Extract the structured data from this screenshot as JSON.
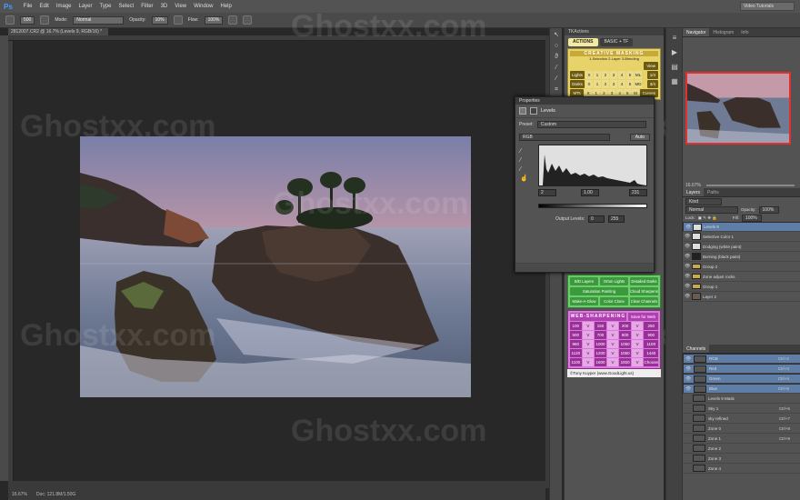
{
  "menubar": {
    "logo": "Ps",
    "items": [
      "File",
      "Edit",
      "Image",
      "Layer",
      "Type",
      "Select",
      "Filter",
      "3D",
      "View",
      "Window",
      "Help"
    ],
    "workspace": "Video Tutorials"
  },
  "options": {
    "brush_size": "500",
    "mode_label": "Mode:",
    "mode_value": "Normal",
    "opacity_label": "Opacity:",
    "opacity_value": "10%",
    "flow_label": "Flow:",
    "flow_value": "100%"
  },
  "document": {
    "tab_title": "2812007.CR2 @ 16.7% (Levels 9, RGB/16) *",
    "zoom": "16.67%",
    "doc_info": "Doc: 121.8M/1.50G"
  },
  "watermark": "Ghostxx.com",
  "actions_panel": {
    "title": "TKActions",
    "tabs": [
      "ACTIONS",
      "BASIC + TF"
    ],
    "creative_masking": {
      "title": "CREATIVE MASKING",
      "subtitle": "1-Selection 2-Layer 3-Blending",
      "rows": [
        {
          "label": "Lights",
          "nums": [
            "X",
            "1",
            "2",
            "3",
            "4",
            "5",
            "ML"
          ],
          "btn": "1/4"
        },
        {
          "label": "Darks",
          "nums": [
            "X",
            "1",
            "2",
            "3",
            "4",
            "5",
            "MD"
          ],
          "btn": "3/4"
        },
        {
          "label": "MTs",
          "nums": [
            "X",
            "1",
            "2",
            "3",
            "4",
            "5",
            "M"
          ],
          "btn": "Curves"
        }
      ],
      "view_btn": "View"
    },
    "green_buttons": [
      "B/D Layers",
      "Orton Lights",
      "Detailed Darks",
      "Saturation Painting",
      "Cloud Sharpening",
      "Make-A-Glow",
      "Color Clone",
      "Clear Channels"
    ],
    "web_sharpening": {
      "title": "WEB-SHARPENING",
      "save": "Save for Web",
      "rows": [
        [
          "100",
          "V",
          "150",
          "V",
          "200",
          "V",
          "250"
        ],
        [
          "500",
          "V",
          "700",
          "V",
          "800",
          "V",
          "900"
        ],
        [
          "960",
          "V",
          "1000",
          "V",
          "1050",
          "V",
          "1100"
        ],
        [
          "1120",
          "V",
          "1200",
          "V",
          "1050",
          "V",
          "1440"
        ],
        [
          "1100",
          "V",
          "1600",
          "V",
          "1920",
          "V",
          "Choose"
        ]
      ]
    },
    "footer": "©Tony Kuyper (www.GoodLight.us)"
  },
  "properties_panel": {
    "title": "Properties",
    "adjust_name": "Levels",
    "preset_label": "Preset:",
    "preset_value": "Custom",
    "channel_value": "RGB",
    "auto_btn": "Auto",
    "input_black": "2",
    "input_mid": "1.00",
    "input_white": "231",
    "output_label": "Output Levels:",
    "output_black": "0",
    "output_white": "255"
  },
  "right_panel": {
    "tabs": [
      "Navigator",
      "Histogram",
      "Info"
    ],
    "zoom": "16.67%",
    "layer_tabs": [
      "Layers",
      "Paths"
    ],
    "kind": "Kind",
    "blend": "Normal",
    "opacity_label": "Opacity:",
    "opacity_value": "100%",
    "lock_label": "Lock:",
    "fill_label": "Fill:",
    "fill_value": "100%",
    "layers": [
      {
        "name": "Levels 9",
        "selected": true,
        "thumb": "light"
      },
      {
        "name": "Selective Color 1",
        "selected": false,
        "thumb": "light"
      },
      {
        "name": "Dodging (white paint)",
        "selected": false,
        "thumb": "light"
      },
      {
        "name": "Burning (black paint)",
        "selected": false,
        "thumb": "dark"
      },
      {
        "name": "Group 2",
        "selected": false,
        "thumb": "folder"
      },
      {
        "name": "Zone adjust rocks",
        "selected": false,
        "thumb": "folder"
      },
      {
        "name": "Group 1",
        "selected": false,
        "thumb": "folder"
      },
      {
        "name": "Layer 2",
        "selected": false,
        "thumb": "photo"
      }
    ],
    "channels_tab": "Channels",
    "channels": [
      {
        "name": "RGB",
        "key": "Ctrl+2",
        "selected": true
      },
      {
        "name": "Red",
        "key": "Ctrl+3",
        "selected": true
      },
      {
        "name": "Green",
        "key": "Ctrl+4",
        "selected": true
      },
      {
        "name": "Blue",
        "key": "Ctrl+5",
        "selected": true
      },
      {
        "name": "Levels 9 Mask",
        "key": "",
        "selected": false
      },
      {
        "name": "Sky 1",
        "key": "Ctrl+6",
        "selected": false
      },
      {
        "name": "sky refined",
        "key": "Ctrl+7",
        "selected": false
      },
      {
        "name": "Zone 0",
        "key": "Ctrl+8",
        "selected": false
      },
      {
        "name": "Zone 1",
        "key": "Ctrl+9",
        "selected": false
      },
      {
        "name": "Zone 2",
        "key": "",
        "selected": false
      },
      {
        "name": "Zone 3",
        "key": "",
        "selected": false
      },
      {
        "name": "Zone 4",
        "key": "",
        "selected": false
      }
    ]
  }
}
